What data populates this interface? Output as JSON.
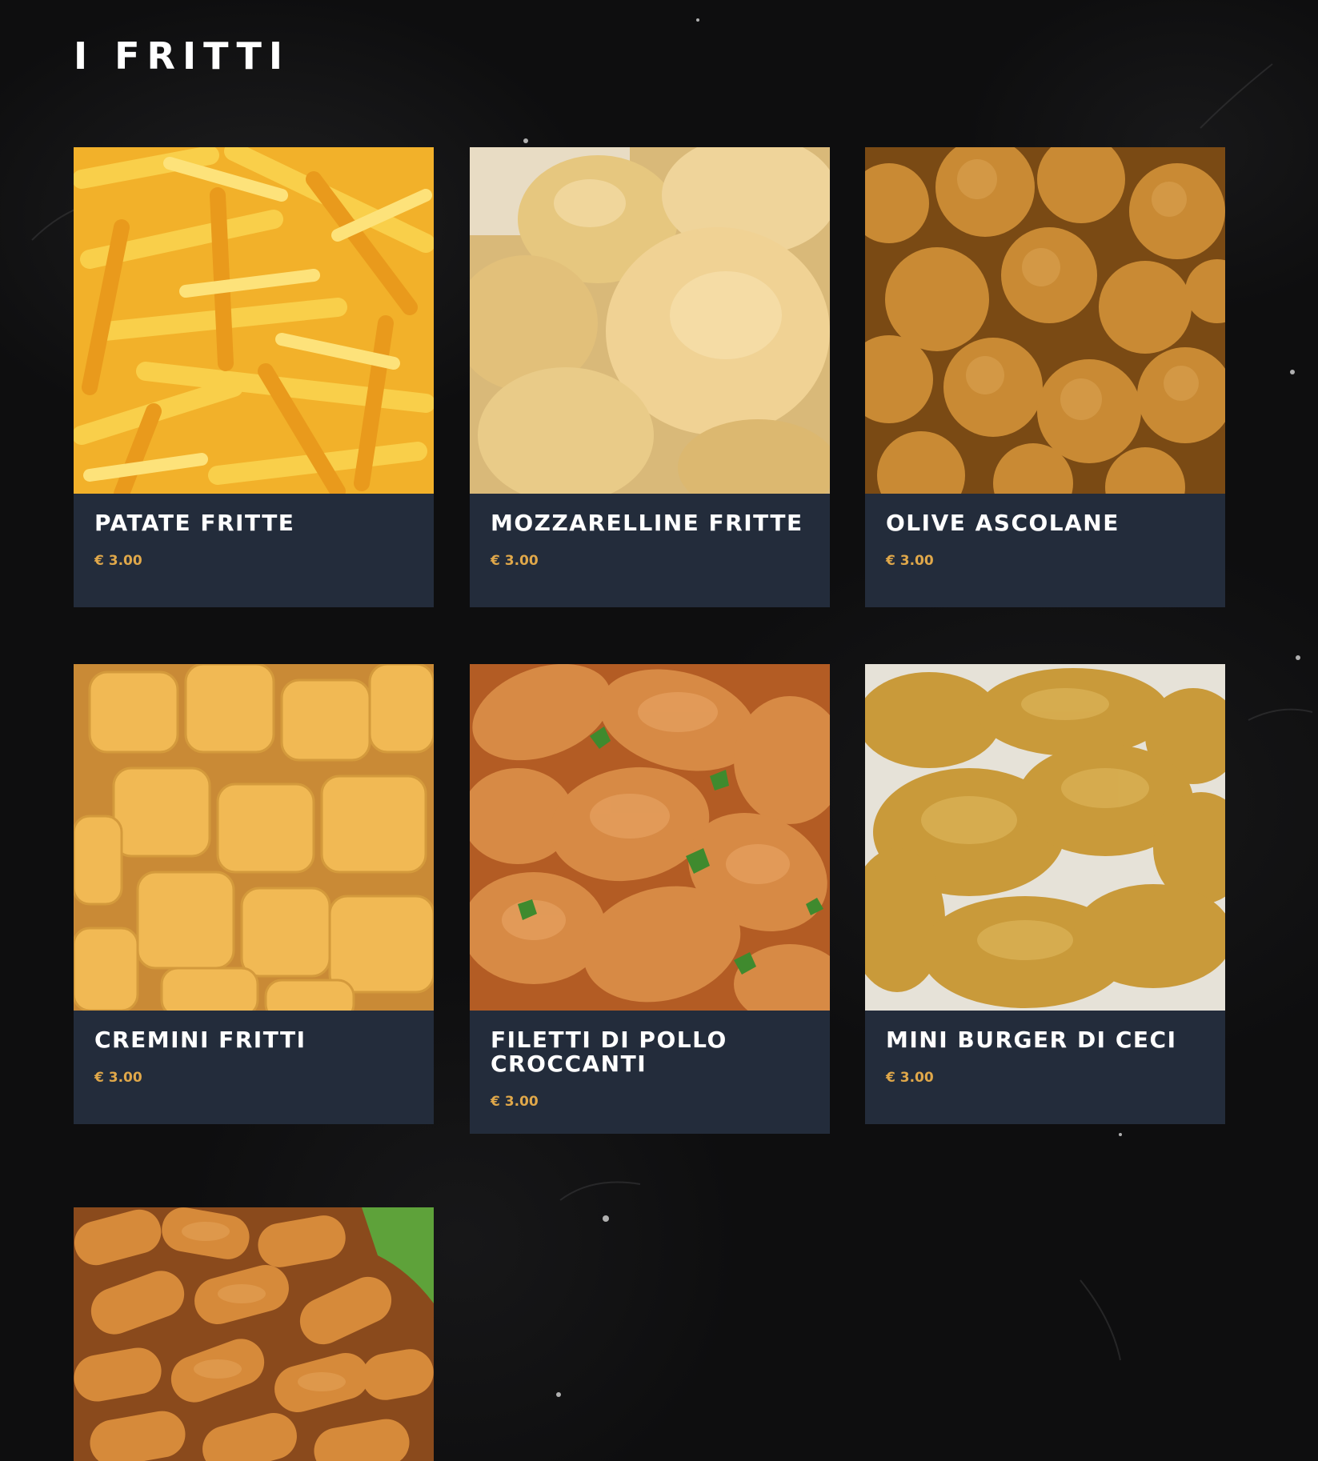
{
  "section": {
    "title": "I FRITTI"
  },
  "colors": {
    "background": "#0e0e0f",
    "card_info_bg": "#232c3b",
    "title_text": "#ffffff",
    "price_text": "#e0a84a"
  },
  "items": [
    {
      "name": "PATATE FRITTE",
      "price": "€ 3.00",
      "image": "french-fries-photo"
    },
    {
      "name": "MOZZARELLINE FRITTE",
      "price": "€ 3.00",
      "image": "fried-mozzarella-balls-photo"
    },
    {
      "name": "OLIVE ASCOLANE",
      "price": "€ 3.00",
      "image": "fried-olives-photo"
    },
    {
      "name": "CREMINI FRITTI",
      "price": "€ 3.00",
      "image": "fried-cream-cubes-photo"
    },
    {
      "name": "FILETTI DI POLLO CROCCANTI",
      "price": "€ 3.00",
      "image": "crispy-chicken-fillets-photo"
    },
    {
      "name": "MINI BURGER DI CECI",
      "price": "€ 3.00",
      "image": "chickpea-fritters-photo"
    },
    {
      "name": "",
      "price": "",
      "image": "croquettes-photo"
    }
  ]
}
